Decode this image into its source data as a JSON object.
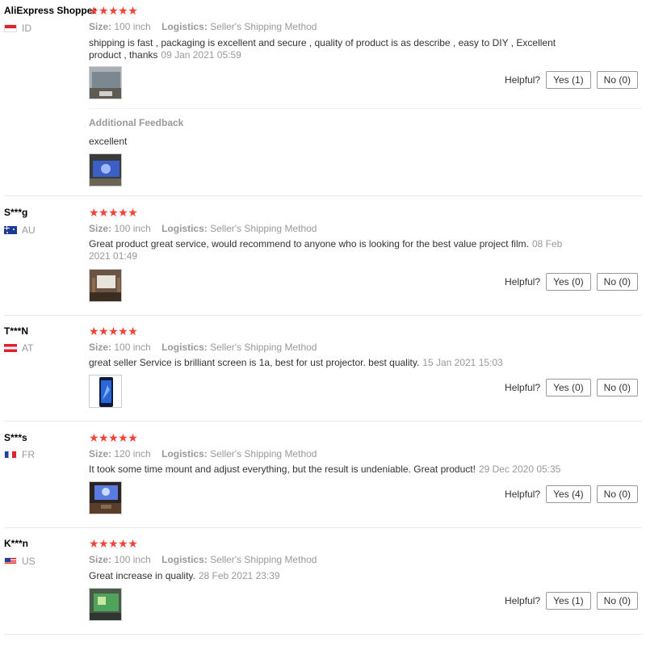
{
  "labels": {
    "size": "Size:",
    "logistics": "Logistics:",
    "helpful": "Helpful?",
    "additional": "Additional Feedback"
  },
  "reviews": [
    {
      "user": "AliExpress Shopper",
      "country": "ID",
      "flag": "id",
      "rating": 5,
      "size": "100 inch",
      "logistics": "Seller's Shipping Method",
      "text": "shipping is fast , packaging is excellent and secure , quality of product is as describe , easy to DIY , Excellent product , thanks",
      "date": "09 Jan 2021 05:59",
      "yes": "Yes (1)",
      "no": "No (0)",
      "additional_text": "excellent"
    },
    {
      "user": "S***g",
      "country": "AU",
      "flag": "au",
      "rating": 5,
      "size": "100 inch",
      "logistics": "Seller's Shipping Method",
      "text": "Great product great service, would recommend to anyone who is looking for the best value project film.",
      "date": "08 Feb 2021 01:49",
      "yes": "Yes (0)",
      "no": "No (0)"
    },
    {
      "user": "T***N",
      "country": "AT",
      "flag": "at",
      "rating": 5,
      "size": "100 inch",
      "logistics": "Seller's Shipping Method",
      "text": "great seller Service is brilliant screen is 1a, best for ust projector. best quality.",
      "date": "15 Jan 2021 15:03",
      "yes": "Yes (0)",
      "no": "No (0)"
    },
    {
      "user": "S***s",
      "country": "FR",
      "flag": "fr",
      "rating": 5,
      "size": "120 inch",
      "logistics": "Seller's Shipping Method",
      "text": "It took some time mount and adjust everything, but the result is undeniable. Great product!",
      "date": "29 Dec 2020 05:35",
      "yes": "Yes (4)",
      "no": "No (0)"
    },
    {
      "user": "K***n",
      "country": "US",
      "flag": "us",
      "rating": 5,
      "size": "100 inch",
      "logistics": "Seller's Shipping Method",
      "text": "Great increase in quality.",
      "date": "28 Feb 2021 23:39",
      "yes": "Yes (1)",
      "no": "No (0)"
    }
  ]
}
